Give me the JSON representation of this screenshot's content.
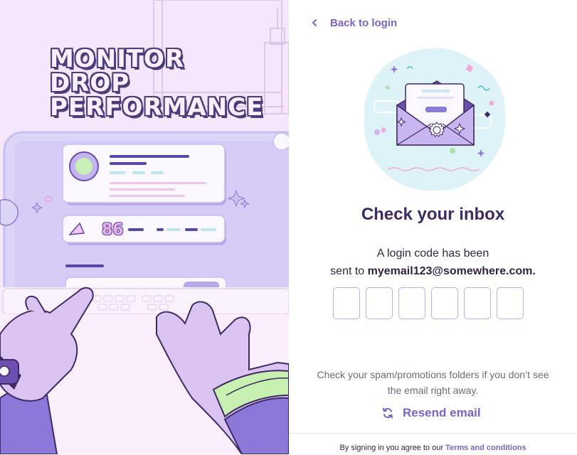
{
  "hero": {
    "title_line1": "MONITOR DROP",
    "title_line2": "PERFORMANCE",
    "score": "86"
  },
  "nav": {
    "back_label": "Back to login"
  },
  "main": {
    "title": "Check your inbox",
    "desc_line1": "A login code has been",
    "desc_prefix": "sent to ",
    "email": "myemail123@somewhere.com.",
    "code_boxes": [
      "",
      "",
      "",
      "",
      "",
      ""
    ],
    "spam_line1": "Check your spam/promotions folders if you don’t see",
    "spam_line2": "the email right away.",
    "resend_label": "Resend email"
  },
  "footer": {
    "prefix": "By signing in you agree to our ",
    "link": "Terms and conditions"
  },
  "icons": {
    "back": "chevron-left-icon",
    "resend": "refresh-icon",
    "illustration": "envelope-illustration"
  },
  "colors": {
    "accent": "#7b63c9",
    "heading": "#3d2b63",
    "left_bg": "#f5e6fb",
    "box_border": "#b9b0e6"
  }
}
